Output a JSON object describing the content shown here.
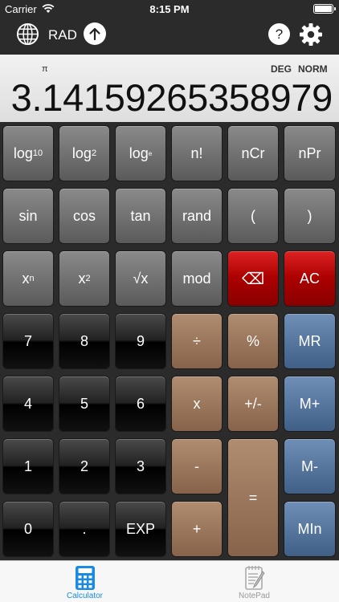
{
  "status_bar": {
    "carrier": "Carrier",
    "time": "8:15 PM",
    "battery_level": 1.0
  },
  "toolbar": {
    "angle_mode_label": "RAD",
    "help_label": "?",
    "icons": [
      "globe-icon",
      "upload-icon",
      "help-icon",
      "gear-icon"
    ]
  },
  "display": {
    "memory_indicator": "π",
    "angle_unit": "DEG",
    "notation": "NORM",
    "value": "3.14159265358979"
  },
  "keys": {
    "log10": {
      "main": "log",
      "sub": "10"
    },
    "log2": {
      "main": "log",
      "sub": "2"
    },
    "loge": {
      "main": "log",
      "sub": "e"
    },
    "factorial": "n!",
    "ncr": "nCr",
    "npr": "nPr",
    "sin": "sin",
    "cos": "cos",
    "tan": "tan",
    "rand": "rand",
    "paren_open": "(",
    "paren_close": ")",
    "power": {
      "main": "x",
      "sup": "n"
    },
    "square": {
      "main": "x",
      "sup": "2"
    },
    "sqrt": "√x",
    "mod": "mod",
    "backspace": "⌫",
    "clear": "AC",
    "seven": "7",
    "eight": "8",
    "nine": "9",
    "divide": "÷",
    "percent": "%",
    "mr": "MR",
    "four": "4",
    "five": "5",
    "six": "6",
    "multiply": "x",
    "negate": "+/-",
    "mplus": "M+",
    "one": "1",
    "two": "2",
    "three": "3",
    "minus": "-",
    "equals": "=",
    "mminus": "M-",
    "zero": "0",
    "decimal": ".",
    "exp": "EXP",
    "plus": "+",
    "min": "MIn"
  },
  "tabs": [
    {
      "label": "Calculator",
      "selected": true
    },
    {
      "label": "NotePad",
      "selected": false
    }
  ],
  "colors": {
    "function_key": "#6e6e6e",
    "digit_key": "#111111",
    "operator_key": "#9c7a5e",
    "memory_key": "#55749c",
    "clear_key": "#b00000",
    "tab_active": "#1a8be0",
    "tab_inactive": "#999999"
  }
}
